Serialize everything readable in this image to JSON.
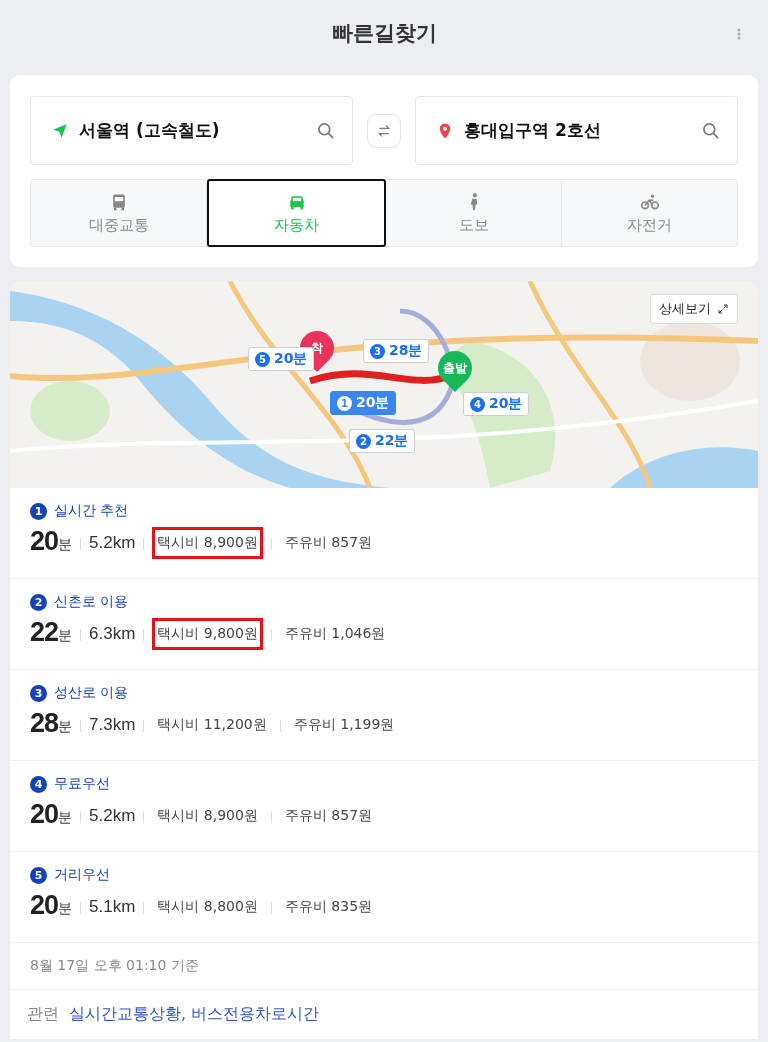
{
  "header": {
    "title": "빠른길찾기"
  },
  "origin": {
    "value": "서울역 (고속철도)"
  },
  "destination": {
    "value": "홍대입구역 2호선"
  },
  "modes": [
    {
      "kind": "bus",
      "label": "대중교통",
      "selected": false
    },
    {
      "kind": "car",
      "label": "자동차",
      "selected": true
    },
    {
      "kind": "walk",
      "label": "도보",
      "selected": false
    },
    {
      "kind": "bike",
      "label": "자전거",
      "selected": false
    }
  ],
  "map": {
    "detail_button": "상세보기",
    "pins": [
      {
        "kind": "end",
        "label": "착"
      },
      {
        "kind": "start",
        "label": "출발"
      }
    ],
    "badges": [
      {
        "number": "5",
        "time": "20분",
        "selected": false
      },
      {
        "number": "3",
        "time": "28분",
        "selected": false
      },
      {
        "number": "1",
        "time": "20분",
        "selected": true
      },
      {
        "number": "4",
        "time": "20분",
        "selected": false
      },
      {
        "number": "2",
        "time": "22분",
        "selected": false
      }
    ]
  },
  "routes": [
    {
      "number": "1",
      "name": "실시간 추천",
      "minutes": "20",
      "unit": "분",
      "distance": "5.2km",
      "taxi": "택시비 8,900원",
      "fuel": "주유비 857원",
      "highlighted": true
    },
    {
      "number": "2",
      "name": "신촌로 이용",
      "minutes": "22",
      "unit": "분",
      "distance": "6.3km",
      "taxi": "택시비 9,800원",
      "fuel": "주유비 1,046원",
      "highlighted": true
    },
    {
      "number": "3",
      "name": "성산로 이용",
      "minutes": "28",
      "unit": "분",
      "distance": "7.3km",
      "taxi": "택시비 11,200원",
      "fuel": "주유비 1,199원",
      "highlighted": false
    },
    {
      "number": "4",
      "name": "무료우선",
      "minutes": "20",
      "unit": "분",
      "distance": "5.2km",
      "taxi": "택시비 8,900원",
      "fuel": "주유비 857원",
      "highlighted": false
    },
    {
      "number": "5",
      "name": "거리우선",
      "minutes": "20",
      "unit": "분",
      "distance": "5.1km",
      "taxi": "택시비 8,800원",
      "fuel": "주유비 835원",
      "highlighted": false
    }
  ],
  "timestamp": "8월 17일 오후 01:10 기준",
  "related": {
    "label": "관련",
    "links": [
      "실시간교통상황,",
      "버스전용차로시간"
    ]
  }
}
